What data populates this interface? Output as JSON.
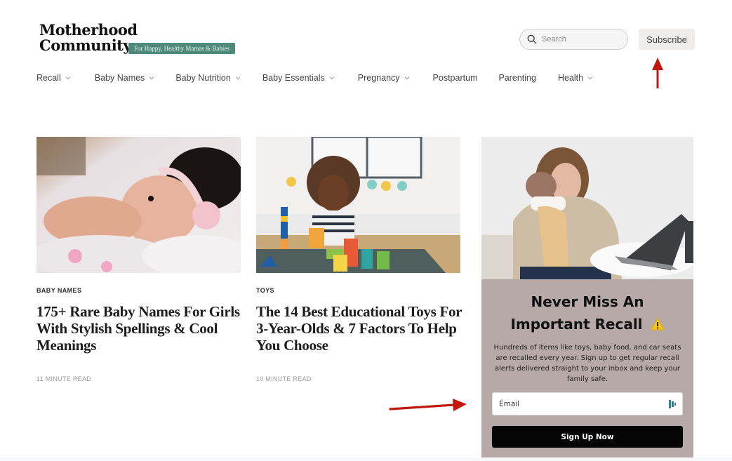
{
  "header": {
    "logo": {
      "line1": "Motherhood",
      "line2": "Community",
      "tagline": "For Happy, Healthy Mamas & Babies",
      "tagline_color": "#4d8a7c"
    },
    "search": {
      "placeholder": "Search",
      "icon": "search-icon"
    },
    "subscribe_label": "Subscribe"
  },
  "nav": {
    "items": [
      {
        "label": "Recall",
        "has_dropdown": true
      },
      {
        "label": "Baby Names",
        "has_dropdown": true
      },
      {
        "label": "Baby Nutrition",
        "has_dropdown": true
      },
      {
        "label": "Baby Essentials",
        "has_dropdown": true
      },
      {
        "label": "Pregnancy",
        "has_dropdown": true
      },
      {
        "label": "Postpartum",
        "has_dropdown": false
      },
      {
        "label": "Parenting",
        "has_dropdown": false
      },
      {
        "label": "Health",
        "has_dropdown": true
      }
    ]
  },
  "articles": [
    {
      "image": "baby-with-headband-photo",
      "category": "BABY NAMES",
      "title": "175+ Rare Baby Names For Girls With Stylish Spellings & Cool Meanings",
      "read_time": "11 MINUTE READ"
    },
    {
      "image": "child-playing-blocks-photo",
      "category": "TOYS",
      "title": "The 14 Best Educational Toys For 3-Year-Olds & 7 Factors To Help You Choose",
      "read_time": "10 MINUTE READ"
    }
  ],
  "signup": {
    "image": "mother-holding-baby-laptop-photo",
    "title": "Never Miss An Important Recall",
    "title_icon": "⚠️",
    "description": "Hundreds of items like toys, baby food, and car seats are recalled every year. Sign up to get regular recall alerts delivered straight to your inbox and keep your family safe.",
    "email_placeholder": "Email",
    "button_label": "Sign Up Now",
    "background_color": "#b8a9a9"
  },
  "annotations": {
    "arrow_color": "#c0180c",
    "arrows": [
      "points-to-subscribe-button",
      "points-to-email-field"
    ]
  }
}
